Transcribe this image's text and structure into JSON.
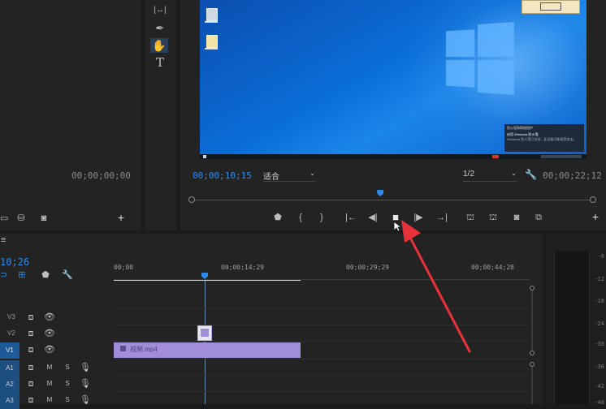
{
  "source_monitor": {
    "timecode": "00;00;00;00"
  },
  "program_monitor": {
    "current_time": "00;00;10;15",
    "fit_select": "适合",
    "resolution_select": "1/2",
    "duration": "00;00;22;12",
    "playhead_fraction": 0.47
  },
  "windows_notification": {
    "title": "防火墙和网络保护",
    "subtitle": "启用 Windows 防火墙",
    "body": "Windows 防火墙已关闭，此设备可能易受攻击。"
  },
  "timeline": {
    "panel_menu": "≡",
    "timecode": "10;26",
    "ruler": [
      "00;00",
      "00;00;14;29",
      "00;00;29;29",
      "00;00;44;28"
    ],
    "tracks": [
      {
        "label": "V3",
        "type": "video"
      },
      {
        "label": "V2",
        "type": "video"
      },
      {
        "label": "V1",
        "type": "video",
        "targeted": true
      },
      {
        "label": "A1",
        "type": "audio",
        "m": "M",
        "s": "S"
      },
      {
        "label": "A2",
        "type": "audio",
        "m": "M",
        "s": "S"
      },
      {
        "label": "A3",
        "type": "audio",
        "m": "M",
        "s": "S"
      }
    ],
    "clip_name": "视频.mp4"
  },
  "audio_meter": {
    "labels": [
      "-6",
      "-12",
      "-18",
      "-24",
      "-30",
      "-36",
      "-42",
      "-48"
    ]
  },
  "colors": {
    "accent": "#2d8ceb",
    "clip": "#a08fd8",
    "desktop": "#0a6ed8",
    "arrow": "#e8323a"
  }
}
